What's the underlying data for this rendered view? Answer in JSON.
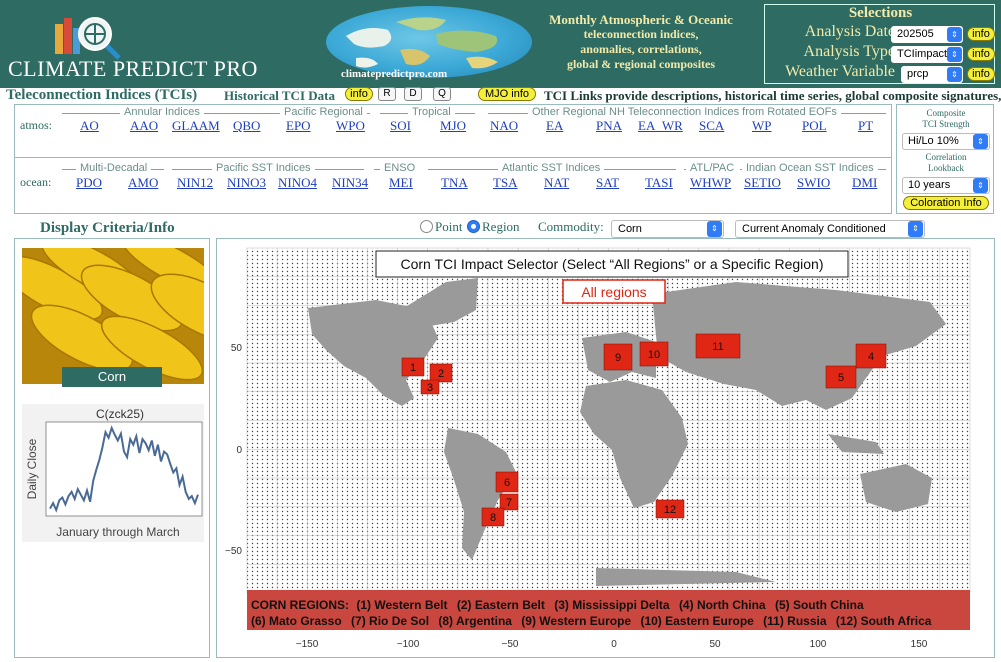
{
  "header": {
    "logo_text": "CLIMATE PREDICT PRO",
    "globe_url": "climatepredictpro.com",
    "tagline": [
      "Monthly Atmospheric & Oceanic",
      "teleconnection indices,",
      "anomalies, correlations,",
      "global & regional composites"
    ]
  },
  "selections": {
    "title": "Selections",
    "analysis_date_label": "Analysis Date",
    "analysis_date_value": "202505",
    "analysis_type_label": "Analysis Type",
    "analysis_type_value": "TCIimpacts",
    "weather_var_label": "Weather Variable",
    "weather_var_value": "prcp",
    "info_label": "info"
  },
  "tci": {
    "title": "Teleconnection Indices (TCIs)",
    "historical_label": "Historical TCI Data",
    "info_label": "info",
    "buttons": [
      "R",
      "D",
      "Q"
    ],
    "mjo_info": "MJO info",
    "description": "TCI Links provide descriptions, historical time series, global composite signatures, etc."
  },
  "atmos": {
    "label": "atmos:",
    "groups": [
      "Annular Indices",
      "Pacific Regional",
      "Tropical",
      "Other Regional NH Teleconnection Indices from Rotated EOFs"
    ],
    "indices": [
      "AO",
      "AAO",
      "GLAAM",
      "QBO",
      "EPO",
      "WPO",
      "SOI",
      "MJO",
      "NAO",
      "EA",
      "PNA",
      "EA_WR",
      "SCA",
      "WP",
      "POL",
      "PT"
    ]
  },
  "ocean": {
    "label": "ocean:",
    "groups": [
      "Multi-Decadal",
      "Pacific SST Indices",
      "ENSO",
      "Atlantic SST Indices",
      "ATL/PAC",
      "Indian Ocean SST Indices"
    ],
    "indices": [
      "PDO",
      "AMO",
      "NIN12",
      "NINO3",
      "NINO4",
      "NIN34",
      "MEI",
      "TNA",
      "TSA",
      "NAT",
      "SAT",
      "TASI",
      "WHWP",
      "SETIO",
      "SWIO",
      "DMI"
    ]
  },
  "composite": {
    "strength_label": [
      "Composite",
      "TCI Strength"
    ],
    "strength_value": "Hi/Lo 10%",
    "lookback_label": [
      "Correlation",
      "Lookback"
    ],
    "lookback_value": "10 years",
    "coloration_info": "Coloration Info"
  },
  "controls": {
    "display_title": "Display Criteria/Info",
    "point_label": "Point",
    "region_label": "Region",
    "selected_mode": "Region",
    "commodity_label": "Commodity:",
    "commodity_value": "Corn",
    "anomaly_value": "Current Anomaly Conditioned"
  },
  "commodity_card": {
    "label": "Corn"
  },
  "price_chart": {
    "title": "C(zck25)",
    "ylabel": "Daily Close",
    "xlabel": "January through March",
    "line_color": "#4a6a96"
  },
  "map": {
    "selector_title": "Corn TCI Impact Selector (Select “All Regions” or a Specific Region)",
    "all_regions": "All regions",
    "x_ticks": [
      "−150",
      "−100",
      "−50",
      "0",
      "50",
      "100",
      "150"
    ],
    "y_ticks": [
      "50",
      "0",
      "−50"
    ],
    "region_markers": [
      "1",
      "2",
      "3",
      "4",
      "5",
      "6",
      "7",
      "8",
      "9",
      "10",
      "11",
      "12"
    ],
    "legend_title": "CORN REGIONS:",
    "legend_items": [
      "(1) Western Belt",
      "(2) Eastern Belt",
      "(3) Mississippi Delta",
      "(4) North China",
      "(5) South China",
      "(6) Mato Grasso",
      "(7) Rio De Sol",
      "(8) Argentina",
      "(9) Western Europe",
      "(10) Eastern Europe",
      "(11) Russia",
      "(12) South Africa"
    ],
    "marker_color": "#e02614",
    "legend_bg": "#c9473e"
  },
  "chart_data": {
    "type": "line",
    "title": "C(zck25)",
    "xlabel": "January through March",
    "ylabel": "Daily Close",
    "series": [
      {
        "values": [
          1.0,
          1.4,
          0.9,
          1.6,
          1.8,
          1.3,
          1.9,
          2.2,
          1.7,
          2.4,
          2.0,
          1.6,
          2.3,
          1.5,
          3.0,
          3.8,
          4.5,
          5.4,
          6.5,
          6.1,
          6.8,
          6.3,
          5.9,
          6.4,
          5.1,
          4.7,
          6.0,
          5.6,
          6.2,
          5.0,
          6.0,
          5.7,
          5.2,
          5.9,
          4.8,
          5.6,
          4.4,
          5.1,
          4.9,
          4.2,
          3.6,
          3.9,
          2.7,
          3.3,
          2.2,
          1.7,
          1.9,
          1.4,
          2.0
        ]
      }
    ]
  }
}
